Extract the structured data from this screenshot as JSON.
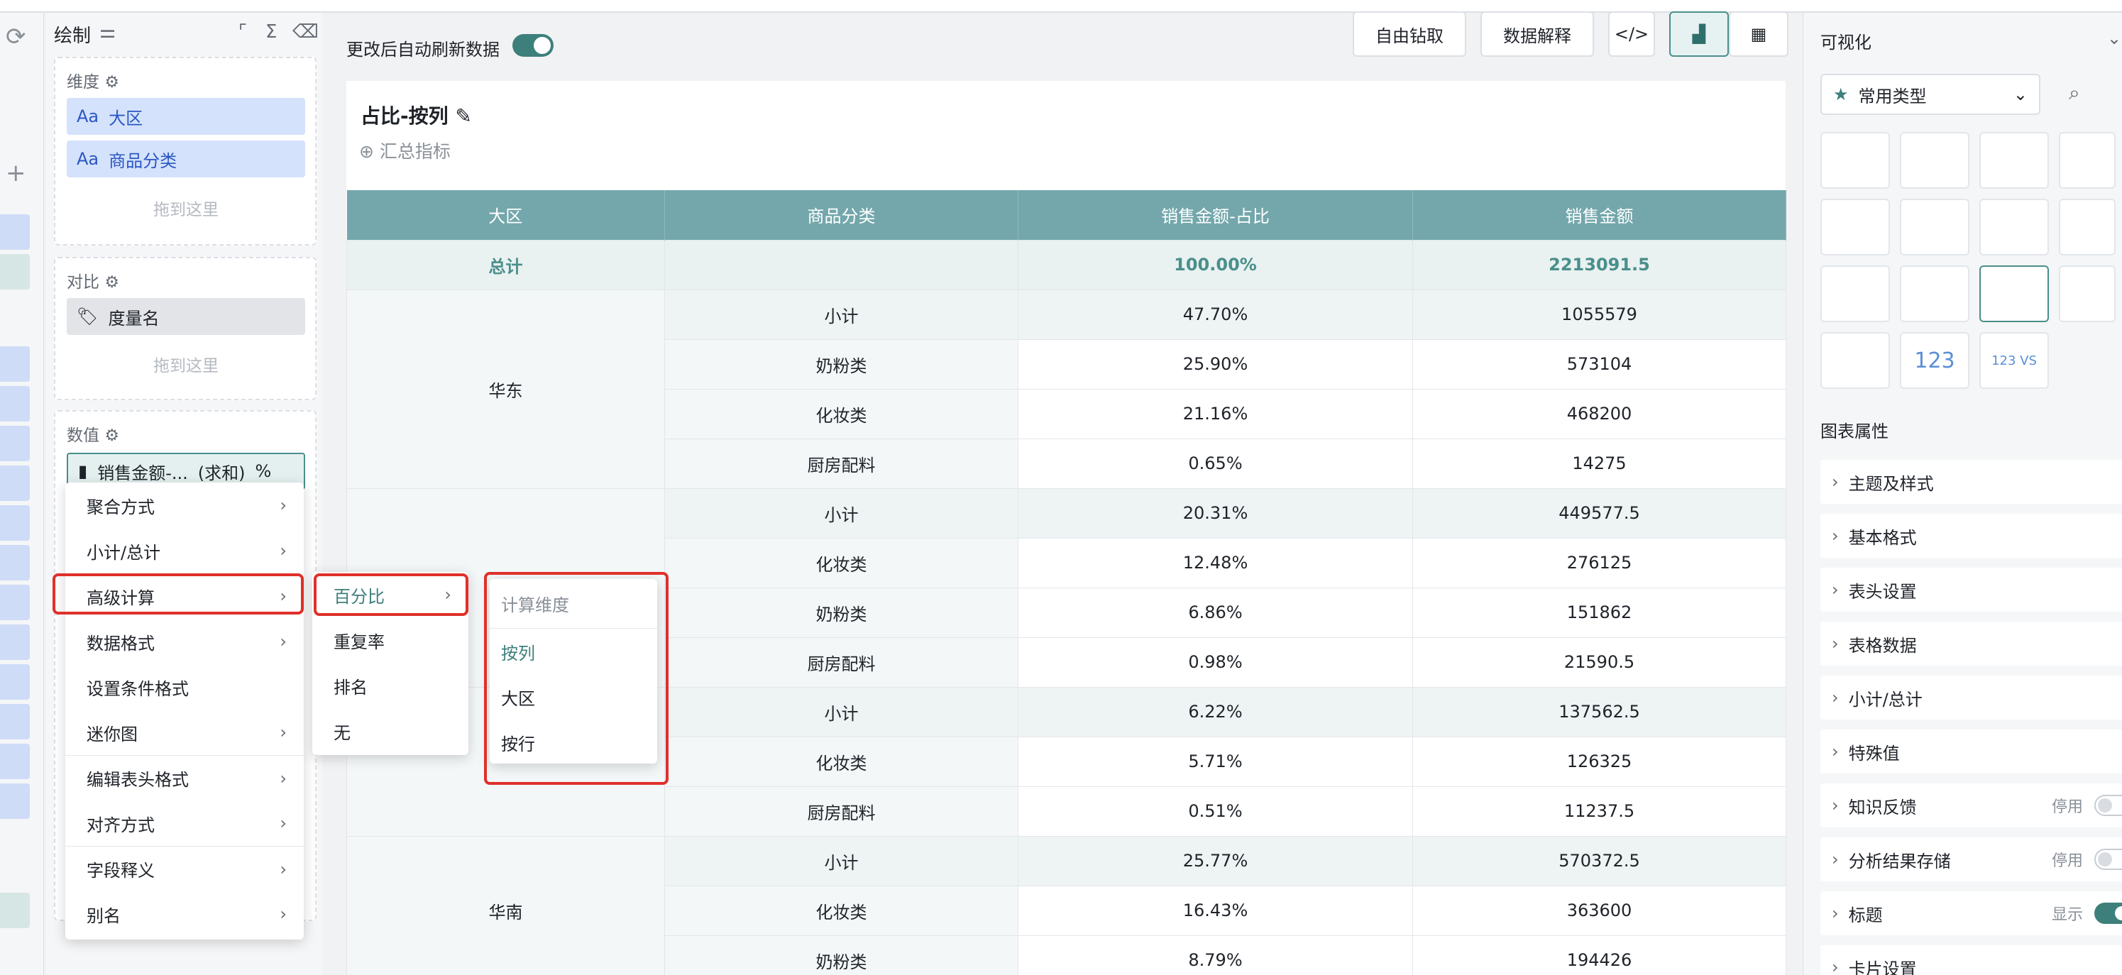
{
  "topbar": {},
  "fields": {
    "title": "绘制",
    "dimensions": {
      "title": "维度",
      "items": [
        {
          "type": "Aa",
          "label": "大区"
        },
        {
          "type": "Aa",
          "label": "商品分类"
        }
      ],
      "drop": "拖到这里"
    },
    "compare": {
      "title": "对比",
      "items": [
        {
          "label": "度量名"
        }
      ],
      "drop": "拖到这里"
    },
    "values": {
      "title": "数值",
      "pill": {
        "label": "销售金额-...",
        "agg": "(求和)",
        "suffix": "%"
      }
    }
  },
  "context_menu": {
    "items": [
      "聚合方式",
      "小计/总计",
      "高级计算",
      "数据格式",
      "设置条件格式",
      "迷你图",
      "编辑表头格式",
      "对齐方式",
      "字段释义",
      "别名"
    ]
  },
  "submenu": {
    "items": [
      "百分比",
      "重复率",
      "排名",
      "无"
    ]
  },
  "submenu2": {
    "header": "计算维度",
    "items": [
      "按列",
      "大区",
      "按行"
    ]
  },
  "toolbar": {
    "auto_refresh": "更改后自动刷新数据",
    "drill": "自由钻取",
    "explain": "数据解释"
  },
  "card": {
    "title": "占比-按列",
    "add_metric": "汇总指标"
  },
  "table": {
    "headers": [
      "大区",
      "商品分类",
      "销售金额-占比",
      "销售金额"
    ],
    "total": {
      "label": "总计",
      "pct": "100.00%",
      "value": "2213091.5"
    },
    "groups": [
      {
        "region": "华东",
        "rows": [
          {
            "cat": "小计",
            "pct": "47.70%",
            "value": "1055579"
          },
          {
            "cat": "奶粉类",
            "pct": "25.90%",
            "value": "573104"
          },
          {
            "cat": "化妆类",
            "pct": "21.16%",
            "value": "468200"
          },
          {
            "cat": "厨房配料",
            "pct": "0.65%",
            "value": "14275"
          }
        ]
      },
      {
        "region": "",
        "rows": [
          {
            "cat": "小计",
            "pct": "20.31%",
            "value": "449577.5"
          },
          {
            "cat": "化妆类",
            "pct": "12.48%",
            "value": "276125"
          },
          {
            "cat": "奶粉类",
            "pct": "6.86%",
            "value": "151862"
          },
          {
            "cat": "厨房配料",
            "pct": "0.98%",
            "value": "21590.5"
          }
        ]
      },
      {
        "region": "",
        "rows": [
          {
            "cat": "小计",
            "pct": "6.22%",
            "value": "137562.5"
          },
          {
            "cat": "化妆类",
            "pct": "5.71%",
            "value": "126325"
          },
          {
            "cat": "厨房配料",
            "pct": "0.51%",
            "value": "11237.5"
          }
        ]
      },
      {
        "region": "华南",
        "rows": [
          {
            "cat": "小计",
            "pct": "25.77%",
            "value": "570372.5"
          },
          {
            "cat": "化妆类",
            "pct": "16.43%",
            "value": "363600"
          },
          {
            "cat": "奶粉类",
            "pct": "8.79%",
            "value": "194426"
          }
        ]
      }
    ]
  },
  "rpanel": {
    "title": "可视化",
    "select": "常用类型",
    "tile_text": {
      "num": "123",
      "vs": "123 VS"
    },
    "props_title": "图表属性",
    "props": [
      {
        "label": "主题及样式"
      },
      {
        "label": "基本格式"
      },
      {
        "label": "表头设置"
      },
      {
        "label": "表格数据"
      },
      {
        "label": "小计/总计"
      },
      {
        "label": "特殊值"
      },
      {
        "label": "知识反馈",
        "state": "停用",
        "on": false
      },
      {
        "label": "分析结果存储",
        "state": "停用",
        "on": false
      },
      {
        "label": "标题",
        "state": "显示",
        "on": true
      },
      {
        "label": "卡片设置"
      }
    ]
  }
}
